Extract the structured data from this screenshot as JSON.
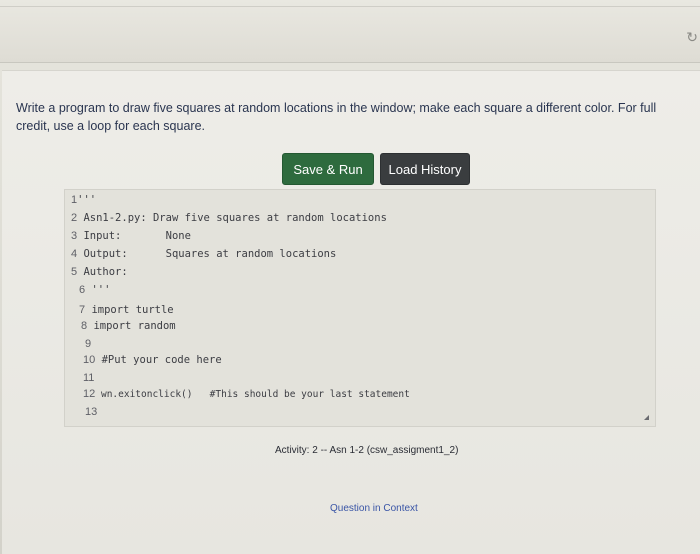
{
  "assignment": {
    "prompt": "Write a program to draw five squares at random locations in the window; make each square a different color. For full credit, use a loop for each square."
  },
  "toolbar": {
    "save_run_label": "Save & Run",
    "load_history_label": "Load History"
  },
  "editor": {
    "lines": [
      {
        "num": "1",
        "text": "'''"
      },
      {
        "num": "2",
        "text": "Asn1-2.py: Draw five squares at random locations"
      },
      {
        "num": "3",
        "text": "Input:       None"
      },
      {
        "num": "4",
        "text": "Output:      Squares at random locations"
      },
      {
        "num": "5",
        "text": "Author:"
      },
      {
        "num": "6",
        "text": "'''"
      },
      {
        "num": "7",
        "text": "import turtle"
      },
      {
        "num": "8",
        "text": "import random"
      },
      {
        "num": "9",
        "text": ""
      },
      {
        "num": "10",
        "text": "#Put your code here"
      },
      {
        "num": "11",
        "text": ""
      },
      {
        "num": "12",
        "text": "wn.exitonclick()   #This should be your last statement"
      },
      {
        "num": "13",
        "text": ""
      }
    ]
  },
  "footer": {
    "activity": "Activity: 2 -- Asn 1-2 (csw_assigment1_2)",
    "question_link": "Question in Context"
  },
  "chrome": {
    "corner_icon": "refresh-icon"
  }
}
